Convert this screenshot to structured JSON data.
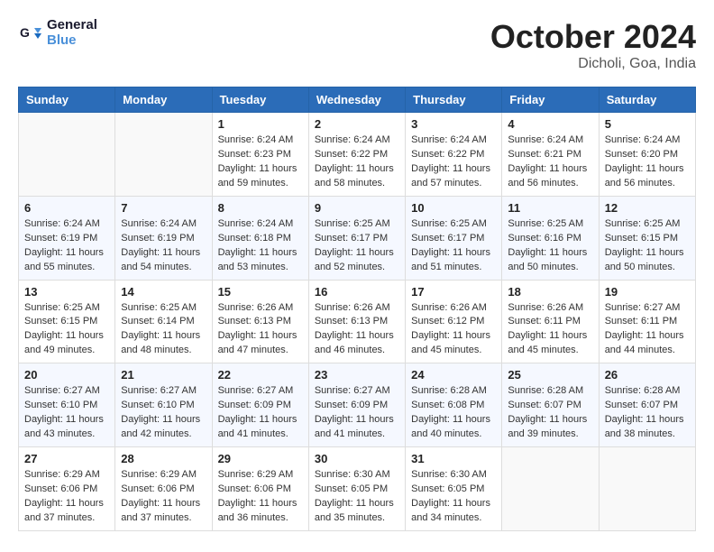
{
  "header": {
    "logo_line1": "General",
    "logo_line2": "Blue",
    "month": "October 2024",
    "location": "Dicholi, Goa, India"
  },
  "days_of_week": [
    "Sunday",
    "Monday",
    "Tuesday",
    "Wednesday",
    "Thursday",
    "Friday",
    "Saturday"
  ],
  "weeks": [
    [
      {
        "day": "",
        "info": ""
      },
      {
        "day": "",
        "info": ""
      },
      {
        "day": "1",
        "info": "Sunrise: 6:24 AM\nSunset: 6:23 PM\nDaylight: 11 hours and 59 minutes."
      },
      {
        "day": "2",
        "info": "Sunrise: 6:24 AM\nSunset: 6:22 PM\nDaylight: 11 hours and 58 minutes."
      },
      {
        "day": "3",
        "info": "Sunrise: 6:24 AM\nSunset: 6:22 PM\nDaylight: 11 hours and 57 minutes."
      },
      {
        "day": "4",
        "info": "Sunrise: 6:24 AM\nSunset: 6:21 PM\nDaylight: 11 hours and 56 minutes."
      },
      {
        "day": "5",
        "info": "Sunrise: 6:24 AM\nSunset: 6:20 PM\nDaylight: 11 hours and 56 minutes."
      }
    ],
    [
      {
        "day": "6",
        "info": "Sunrise: 6:24 AM\nSunset: 6:19 PM\nDaylight: 11 hours and 55 minutes."
      },
      {
        "day": "7",
        "info": "Sunrise: 6:24 AM\nSunset: 6:19 PM\nDaylight: 11 hours and 54 minutes."
      },
      {
        "day": "8",
        "info": "Sunrise: 6:24 AM\nSunset: 6:18 PM\nDaylight: 11 hours and 53 minutes."
      },
      {
        "day": "9",
        "info": "Sunrise: 6:25 AM\nSunset: 6:17 PM\nDaylight: 11 hours and 52 minutes."
      },
      {
        "day": "10",
        "info": "Sunrise: 6:25 AM\nSunset: 6:17 PM\nDaylight: 11 hours and 51 minutes."
      },
      {
        "day": "11",
        "info": "Sunrise: 6:25 AM\nSunset: 6:16 PM\nDaylight: 11 hours and 50 minutes."
      },
      {
        "day": "12",
        "info": "Sunrise: 6:25 AM\nSunset: 6:15 PM\nDaylight: 11 hours and 50 minutes."
      }
    ],
    [
      {
        "day": "13",
        "info": "Sunrise: 6:25 AM\nSunset: 6:15 PM\nDaylight: 11 hours and 49 minutes."
      },
      {
        "day": "14",
        "info": "Sunrise: 6:25 AM\nSunset: 6:14 PM\nDaylight: 11 hours and 48 minutes."
      },
      {
        "day": "15",
        "info": "Sunrise: 6:26 AM\nSunset: 6:13 PM\nDaylight: 11 hours and 47 minutes."
      },
      {
        "day": "16",
        "info": "Sunrise: 6:26 AM\nSunset: 6:13 PM\nDaylight: 11 hours and 46 minutes."
      },
      {
        "day": "17",
        "info": "Sunrise: 6:26 AM\nSunset: 6:12 PM\nDaylight: 11 hours and 45 minutes."
      },
      {
        "day": "18",
        "info": "Sunrise: 6:26 AM\nSunset: 6:11 PM\nDaylight: 11 hours and 45 minutes."
      },
      {
        "day": "19",
        "info": "Sunrise: 6:27 AM\nSunset: 6:11 PM\nDaylight: 11 hours and 44 minutes."
      }
    ],
    [
      {
        "day": "20",
        "info": "Sunrise: 6:27 AM\nSunset: 6:10 PM\nDaylight: 11 hours and 43 minutes."
      },
      {
        "day": "21",
        "info": "Sunrise: 6:27 AM\nSunset: 6:10 PM\nDaylight: 11 hours and 42 minutes."
      },
      {
        "day": "22",
        "info": "Sunrise: 6:27 AM\nSunset: 6:09 PM\nDaylight: 11 hours and 41 minutes."
      },
      {
        "day": "23",
        "info": "Sunrise: 6:27 AM\nSunset: 6:09 PM\nDaylight: 11 hours and 41 minutes."
      },
      {
        "day": "24",
        "info": "Sunrise: 6:28 AM\nSunset: 6:08 PM\nDaylight: 11 hours and 40 minutes."
      },
      {
        "day": "25",
        "info": "Sunrise: 6:28 AM\nSunset: 6:07 PM\nDaylight: 11 hours and 39 minutes."
      },
      {
        "day": "26",
        "info": "Sunrise: 6:28 AM\nSunset: 6:07 PM\nDaylight: 11 hours and 38 minutes."
      }
    ],
    [
      {
        "day": "27",
        "info": "Sunrise: 6:29 AM\nSunset: 6:06 PM\nDaylight: 11 hours and 37 minutes."
      },
      {
        "day": "28",
        "info": "Sunrise: 6:29 AM\nSunset: 6:06 PM\nDaylight: 11 hours and 37 minutes."
      },
      {
        "day": "29",
        "info": "Sunrise: 6:29 AM\nSunset: 6:06 PM\nDaylight: 11 hours and 36 minutes."
      },
      {
        "day": "30",
        "info": "Sunrise: 6:30 AM\nSunset: 6:05 PM\nDaylight: 11 hours and 35 minutes."
      },
      {
        "day": "31",
        "info": "Sunrise: 6:30 AM\nSunset: 6:05 PM\nDaylight: 11 hours and 34 minutes."
      },
      {
        "day": "",
        "info": ""
      },
      {
        "day": "",
        "info": ""
      }
    ]
  ]
}
